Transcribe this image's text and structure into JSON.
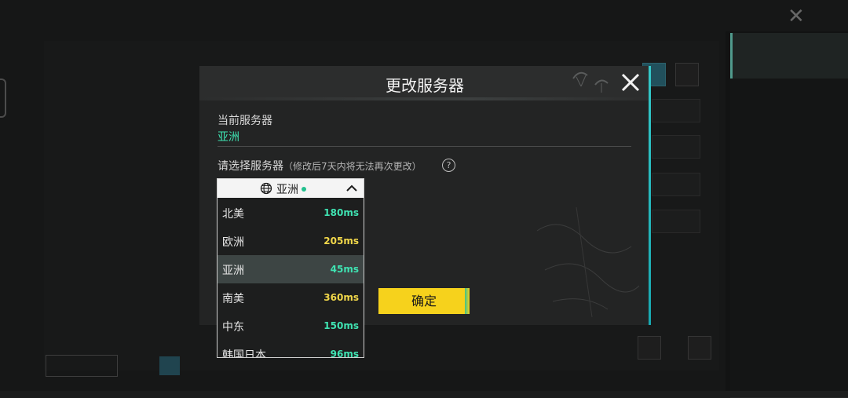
{
  "modal": {
    "title": "更改服务器",
    "current_label": "当前服务器",
    "current_value": "亚洲",
    "select_label": "请选择服务器",
    "select_note": "（修改后7天内将无法再次更改）",
    "help_icon": "?",
    "confirm_label": "确定"
  },
  "dropdown": {
    "selected": "亚洲",
    "options": [
      {
        "name": "北美",
        "ping": "180ms",
        "color": "#3fe3b2"
      },
      {
        "name": "欧洲",
        "ping": "205ms",
        "color": "#f2d84a"
      },
      {
        "name": "亚洲",
        "ping": "45ms",
        "color": "#3fe3b2"
      },
      {
        "name": "南美",
        "ping": "360ms",
        "color": "#f2d84a"
      },
      {
        "name": "中东",
        "ping": "150ms",
        "color": "#3fe3b2"
      },
      {
        "name": "韩国日本",
        "ping": "96ms",
        "color": "#3fe3b2"
      }
    ],
    "selected_index": 2
  },
  "icons": {
    "close": "close-icon",
    "globe": "globe-icon",
    "caret": "chevron-up-icon",
    "help": "help-icon"
  },
  "colors": {
    "accent_green": "#3fe3b2",
    "accent_yellow": "#f6d21c",
    "accent_cyan": "#35c9c9"
  }
}
